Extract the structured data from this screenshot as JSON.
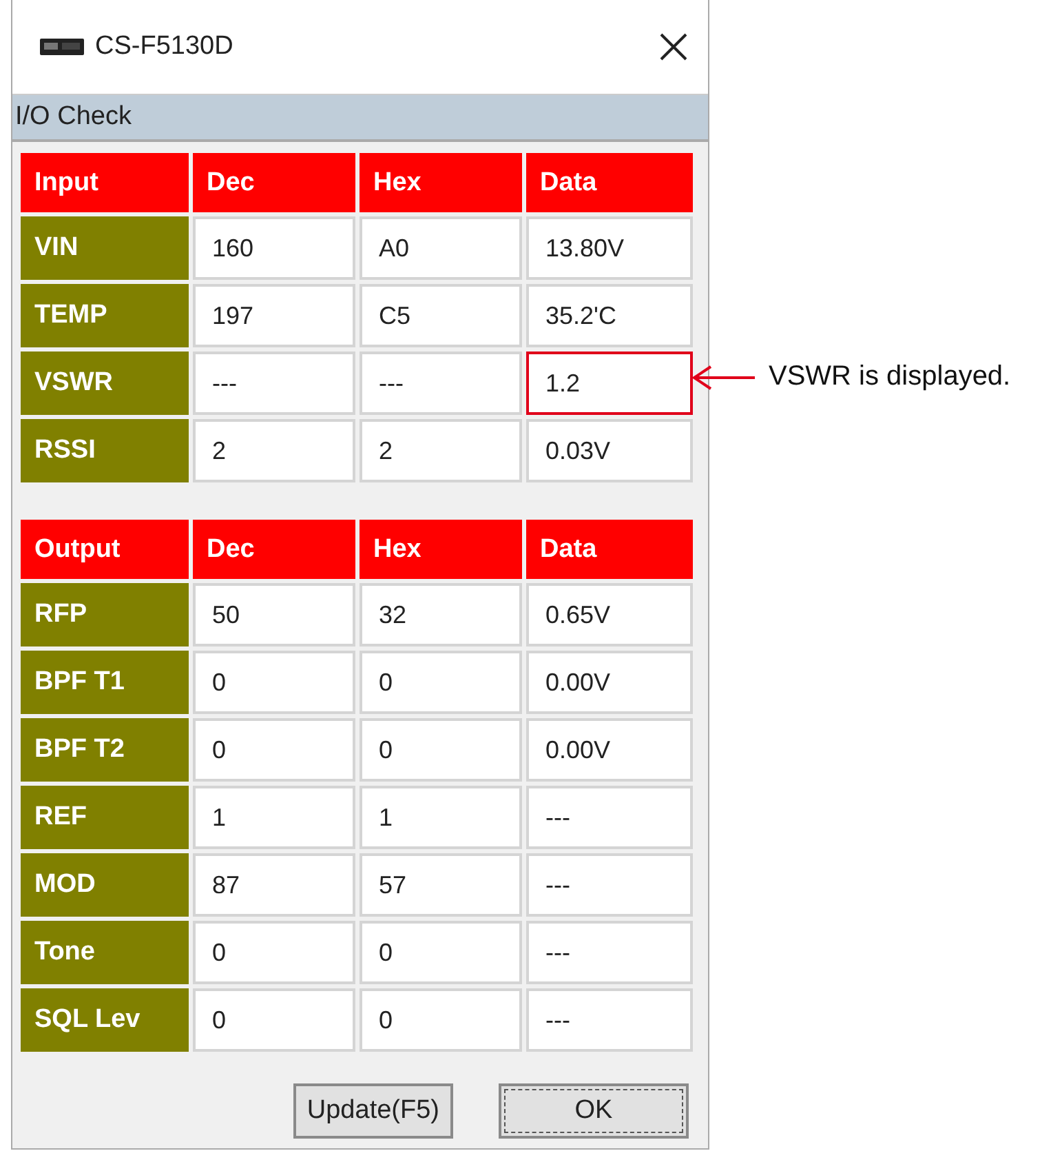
{
  "window": {
    "title": "CS-F5130D",
    "section": "I/O Check"
  },
  "tables": [
    {
      "columns": [
        "Input",
        "Dec",
        "Hex",
        "Data"
      ],
      "rows": [
        {
          "name": "VIN",
          "dec": "160",
          "hex": "A0",
          "data": "13.80V",
          "highlighted": false
        },
        {
          "name": "TEMP",
          "dec": "197",
          "hex": "C5",
          "data": "35.2'C",
          "highlighted": false
        },
        {
          "name": "VSWR",
          "dec": "---",
          "hex": "---",
          "data": "1.2",
          "highlighted": true
        },
        {
          "name": "RSSI",
          "dec": "2",
          "hex": "2",
          "data": "0.03V",
          "highlighted": false
        }
      ]
    },
    {
      "columns": [
        "Output",
        "Dec",
        "Hex",
        "Data"
      ],
      "rows": [
        {
          "name": "RFP",
          "dec": "50",
          "hex": "32",
          "data": "0.65V",
          "highlighted": false
        },
        {
          "name": "BPF T1",
          "dec": "0",
          "hex": "0",
          "data": "0.00V",
          "highlighted": false
        },
        {
          "name": "BPF T2",
          "dec": "0",
          "hex": "0",
          "data": "0.00V",
          "highlighted": false
        },
        {
          "name": "REF",
          "dec": "1",
          "hex": "1",
          "data": "---",
          "highlighted": false
        },
        {
          "name": "MOD",
          "dec": "87",
          "hex": "57",
          "data": "---",
          "highlighted": false
        },
        {
          "name": "Tone",
          "dec": "0",
          "hex": "0",
          "data": "---",
          "highlighted": false
        },
        {
          "name": "SQL Lev",
          "dec": "0",
          "hex": "0",
          "data": "---",
          "highlighted": false
        }
      ]
    }
  ],
  "buttons": [
    {
      "label": "Update(F5)",
      "focused": false
    },
    {
      "label": "OK",
      "focused": true
    }
  ],
  "annotation": {
    "text": "VSWR is displayed."
  }
}
